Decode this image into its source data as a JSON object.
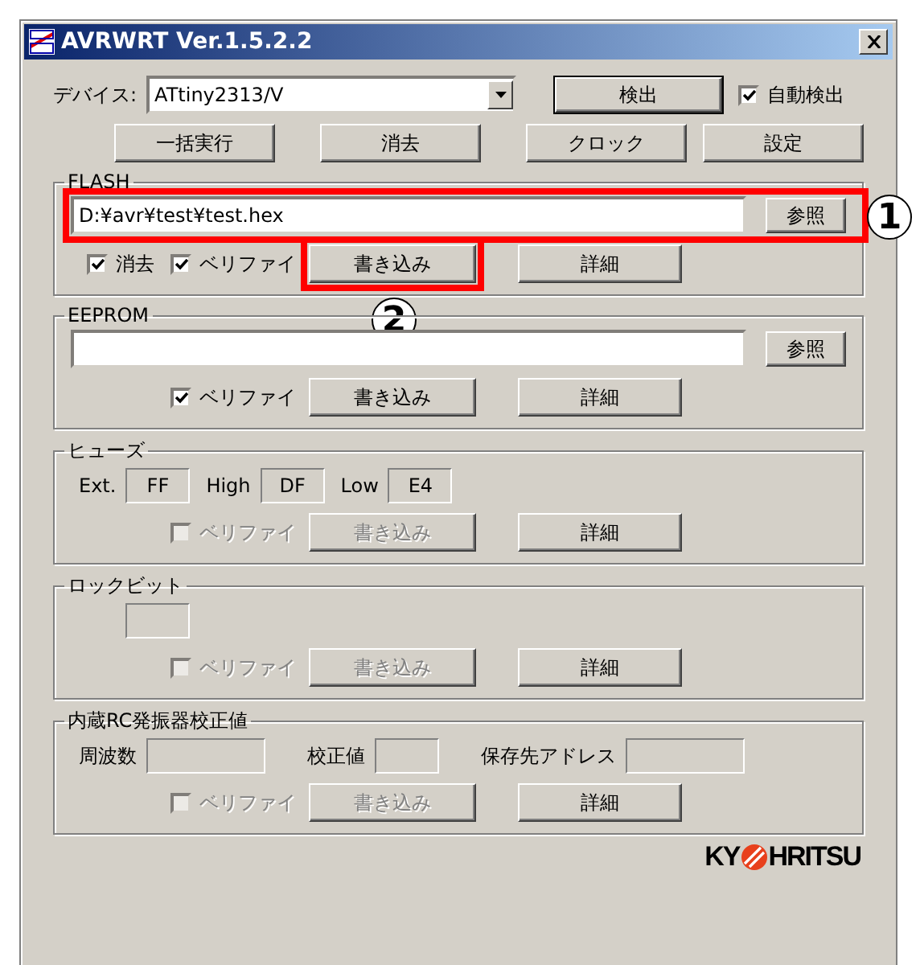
{
  "window": {
    "title": "AVRWRT Ver.1.5.2.2"
  },
  "device": {
    "label": "デバイス:",
    "value": "ATtiny2313/V",
    "detect_button": "検出",
    "auto_detect": {
      "label": "自動検出",
      "checked": true
    }
  },
  "actions": [
    "一括実行",
    "消去",
    "クロック",
    "設定"
  ],
  "groups": [
    {
      "kind": "file",
      "title": "FLASH",
      "file": {
        "value": "D:¥avr¥test¥test.hex",
        "browse": "参照",
        "callout": "1"
      },
      "options": [
        {
          "label": "消去",
          "checked": true,
          "disabled": false
        },
        {
          "label": "ベリファイ",
          "checked": true,
          "disabled": false
        }
      ],
      "write_button": {
        "label": "書き込み",
        "disabled": false,
        "callout": "2"
      },
      "detail_button": "詳細"
    },
    {
      "kind": "file",
      "title": "EEPROM",
      "file": {
        "browse": "参照"
      },
      "options": [
        {
          "label": "ベリファイ",
          "checked": true,
          "disabled": false
        }
      ],
      "write_button": {
        "label": "書き込み",
        "disabled": false
      },
      "detail_button": "詳細"
    },
    {
      "kind": "fuses",
      "title": "ヒューズ",
      "registers": [
        {
          "label": "Ext.",
          "value": "FF"
        },
        {
          "label": "High",
          "value": "DF"
        },
        {
          "label": "Low",
          "value": "E4"
        }
      ],
      "options": [
        {
          "label": "ベリファイ",
          "checked": false,
          "disabled": true
        }
      ],
      "write_button": {
        "label": "書き込み",
        "disabled": true
      },
      "detail_button": "詳細"
    },
    {
      "kind": "lockbits",
      "title": "ロックビット",
      "registers": [
        {
          "kind": "blank"
        }
      ],
      "options": [
        {
          "label": "ベリファイ",
          "checked": false,
          "disabled": true
        }
      ],
      "write_button": {
        "label": "書き込み",
        "disabled": true
      },
      "detail_button": "詳細"
    },
    {
      "kind": "calibration",
      "title": "内蔵RC発振器校正値",
      "registers": [
        {
          "label": "周波数"
        },
        {
          "label": "校正値"
        },
        {
          "label": "保存先アドレス"
        }
      ],
      "options": [
        {
          "label": "ベリファイ",
          "checked": false,
          "disabled": true
        }
      ],
      "write_button": {
        "label": "書き込み",
        "disabled": true
      },
      "detail_button": "詳細"
    }
  ],
  "logo": {
    "left": "KY",
    "right": "HRITSU"
  }
}
